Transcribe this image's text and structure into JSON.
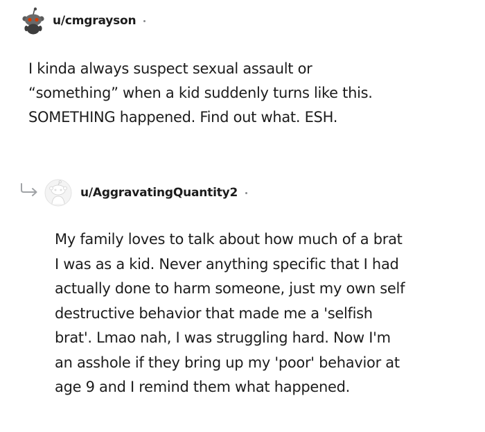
{
  "comments": [
    {
      "username": "u/cmgrayson",
      "avatar_icon": "snoo-avatar-icon",
      "body": "I kinda always suspect sexual assault or\n“something” when a kid suddenly turns like this.\nSOMETHING happened. Find out what. ESH."
    },
    {
      "username": "u/AggravatingQuantity2",
      "avatar_icon": "default-snoo-avatar-icon",
      "reply_icon": "reply-arrow-icon",
      "body": "My family loves to talk about how much of a brat\nI was as a kid. Never anything specific that I had\nactually done to harm someone, just my own self\ndestructive behavior that made me a 'selfish\nbrat'. Lmao nah, I was struggling hard. Now I'm\nan asshole if they bring up my 'poor' behavior at\nage 9 and I remind them what happened."
    }
  ],
  "colors": {
    "text": "#1c1c1c",
    "meta_dot": "#878a8c",
    "reply_arrow": "#a0a3a6",
    "avatar_eye": "#d93a00"
  }
}
